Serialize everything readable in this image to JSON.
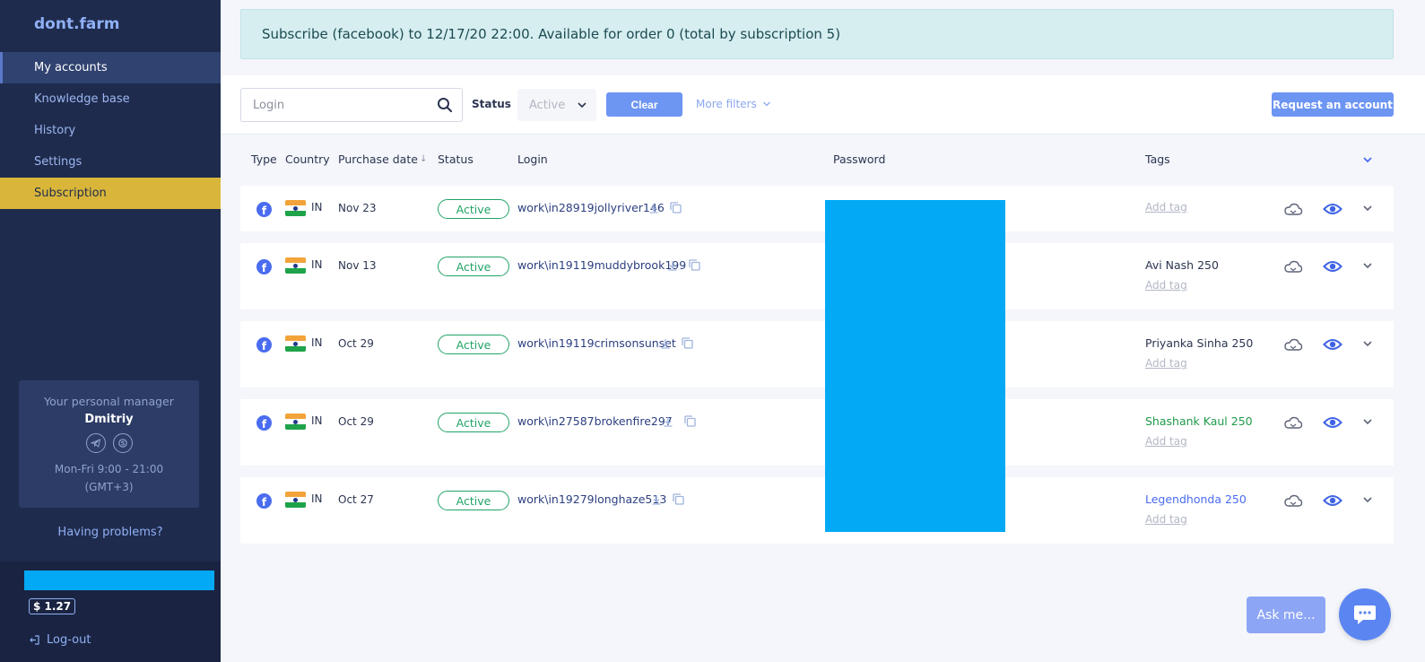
{
  "sidebar": {
    "brand": "dont.farm",
    "items": [
      {
        "label": "My accounts"
      },
      {
        "label": "Knowledge base"
      },
      {
        "label": "History"
      },
      {
        "label": "Settings"
      },
      {
        "label": "Subscription"
      }
    ],
    "manager": {
      "label": "Your personal manager",
      "name": "Dmitriy",
      "hours": "Mon-Fri 9:00 - 21:00",
      "timezone": "(GMT+3)",
      "icons": [
        "telegram-icon",
        "skype-icon"
      ]
    },
    "problems": "Having problems?",
    "balance": "$ 1.27",
    "logout": "Log-out"
  },
  "alert": {
    "text": "Subscribe (facebook) to 12/17/20 22:00. Available for order 0 (total by subscription 5)"
  },
  "filters": {
    "search_placeholder": "Login",
    "status_label": "Status",
    "status_value": "Active",
    "clear_label": "Clear",
    "more_filters_label": "More filters",
    "request_label": "Request an account"
  },
  "table": {
    "headers": {
      "type": "Type",
      "country": "Country",
      "purchase_date": "Purchase date",
      "sort_arrow": "↓",
      "status": "Status",
      "login": "Login",
      "password": "Password",
      "tags": "Tags"
    },
    "rows": [
      {
        "country": "IN",
        "date": "Nov 23",
        "status": "Active",
        "login": "work\\in28919jollyriver146",
        "tag": "",
        "tag_color": "#2c3550",
        "add_tag": "Add tag"
      },
      {
        "country": "IN",
        "date": "Nov 13",
        "status": "Active",
        "login": "work\\in19119muddybrook199",
        "tag": "Avi Nash 250",
        "tag_color": "#2c3550",
        "add_tag": "Add tag"
      },
      {
        "country": "IN",
        "date": "Oct 29",
        "status": "Active",
        "login": "work\\in19119crimsonsunset",
        "tag": "Priyanka Sinha 250",
        "tag_color": "#2c3550",
        "add_tag": "Add tag"
      },
      {
        "country": "IN",
        "date": "Oct 29",
        "status": "Active",
        "login": "work\\in27587brokenfire297",
        "tag": "Shashank Kaul 250",
        "tag_color": "#1f9a4a",
        "add_tag": "Add tag"
      },
      {
        "country": "IN",
        "date": "Oct 27",
        "status": "Active",
        "login": "work\\in19279longhaze513",
        "tag": "Legendhonda 250",
        "tag_color": "#4a6cf0",
        "add_tag": "Add tag"
      }
    ]
  },
  "widgets": {
    "ask_label": "Ask me..."
  },
  "colors": {
    "sidebar_bg": "#1f2b4d",
    "accent": "#6d95f2",
    "active_status": "#21a366",
    "subscription_highlight": "#d9b63a",
    "redaction": "#03a9f4"
  }
}
